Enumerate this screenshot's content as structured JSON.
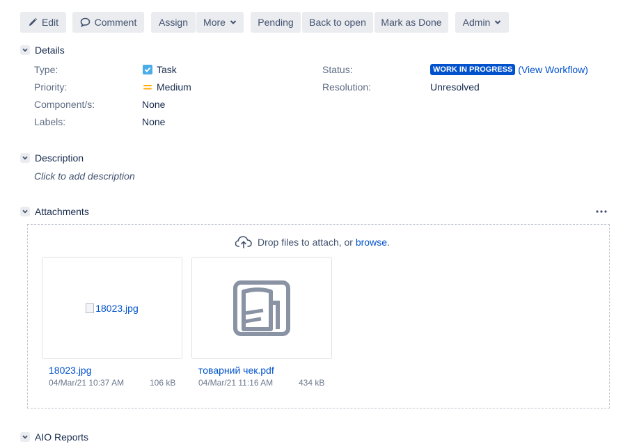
{
  "toolbar": {
    "edit": "Edit",
    "comment": "Comment",
    "assign": "Assign",
    "more": "More",
    "pending": "Pending",
    "back_to_open": "Back to open",
    "mark_as_done": "Mark as Done",
    "admin": "Admin"
  },
  "details": {
    "title": "Details",
    "type_label": "Type:",
    "type_value": "Task",
    "priority_label": "Priority:",
    "priority_value": "Medium",
    "component_label": "Component/s:",
    "component_value": "None",
    "labels_label": "Labels:",
    "labels_value": "None",
    "status_label": "Status:",
    "status_value": "WORK IN PROGRESS",
    "view_workflow": "(View Workflow)",
    "resolution_label": "Resolution:",
    "resolution_value": "Unresolved"
  },
  "description": {
    "title": "Description",
    "placeholder": "Click to add description"
  },
  "attachments": {
    "title": "Attachments",
    "drop_text": "Drop files to attach, or ",
    "browse": "browse",
    "period": ".",
    "files": [
      {
        "preview_alt": "18023.jpg",
        "name": "18023.jpg",
        "date": "04/Mar/21 10:37 AM",
        "size": "106 kB"
      },
      {
        "name": "товарний чек.pdf",
        "date": "04/Mar/21 11:16 AM",
        "size": "434 kB"
      }
    ]
  },
  "next_section": {
    "title": "AIO Reports"
  },
  "colors": {
    "accent": "#0052cc",
    "button_bg": "#ebecf0",
    "status_lozenge": "#0052cc",
    "priority_medium": "#ffab00",
    "checkbox": "#4bade8"
  },
  "icons": [
    "pencil-icon",
    "comment-icon",
    "chevron-down-icon",
    "task-type-icon",
    "priority-medium-icon",
    "upload-cloud-icon",
    "pdf-file-icon",
    "ellipsis-icon"
  ]
}
